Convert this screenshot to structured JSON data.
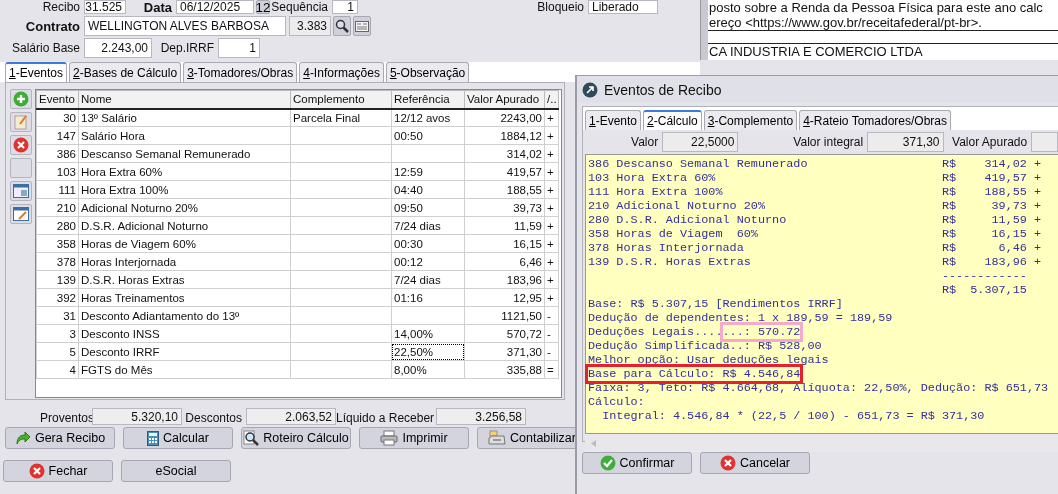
{
  "form": {
    "recibo": {
      "label": "Recibo",
      "value": "31.525"
    },
    "data": {
      "label": "Data",
      "value": "06/12/2025",
      "calendar": "12"
    },
    "sequencia": {
      "label": "Sequência",
      "value": "1"
    },
    "bloqueio": {
      "label": "Bloqueio",
      "value": "Liberado"
    },
    "contrato": {
      "label": "Contrato",
      "name": "WELLINGTON ALVES BARBOSA",
      "code": "3.383"
    },
    "salario_base": {
      "label": "Salário Base",
      "value": "2.243,00"
    },
    "dep_irrf": {
      "label": "Dep.IRRF",
      "value": "1"
    }
  },
  "document": {
    "lines": [
      "posto sobre a Renda da Pessoa Física para este ano calc",
      "ereço <https://www.gov.br/receitafederal/pt-br>.",
      "CA INDUSTRIA E COMERCIO LTDA"
    ]
  },
  "tabs": [
    {
      "label": "1-Eventos",
      "selected": true
    },
    {
      "label": "2-Bases de Cálculo",
      "selected": false
    },
    {
      "label": "3-Tomadores/Obras",
      "selected": false
    },
    {
      "label": "4-Informações",
      "selected": false
    },
    {
      "label": "5-Observação",
      "selected": false
    }
  ],
  "events_table": {
    "columns": [
      "Evento",
      "Nome",
      "Complemento",
      "Referência",
      "Valor Apurado",
      "/.."
    ],
    "rows": [
      {
        "evento": "30",
        "nome": "13º Salário",
        "complemento": "Parcela Final",
        "referencia": "12/12 avos",
        "valor": "2243,00",
        "sinal": "+",
        "focused": false
      },
      {
        "evento": "147",
        "nome": "Salário Hora",
        "referencia": "00:50",
        "valor": "1884,12",
        "sinal": "+",
        "focused": false
      },
      {
        "evento": "386",
        "nome": "Descanso Semanal Remunerado",
        "valor": "314,02",
        "sinal": "+",
        "focused": false
      },
      {
        "evento": "103",
        "nome": "Hora Extra 60%",
        "referencia": "12:59",
        "valor": "419,57",
        "sinal": "+",
        "focused": false
      },
      {
        "evento": "111",
        "nome": "Hora Extra 100%",
        "referencia": "04:40",
        "valor": "188,55",
        "sinal": "+",
        "focused": false
      },
      {
        "evento": "210",
        "nome": "Adicional Noturno 20%",
        "referencia": "09:50",
        "valor": "39,73",
        "sinal": "+",
        "focused": false
      },
      {
        "evento": "280",
        "nome": "D.S.R. Adicional Noturno",
        "referencia": "7/24 dias",
        "valor": "11,59",
        "sinal": "+",
        "focused": false
      },
      {
        "evento": "358",
        "nome": "Horas de Viagem  60%",
        "referencia": "00:30",
        "valor": "16,15",
        "sinal": "+",
        "focused": false
      },
      {
        "evento": "378",
        "nome": "Horas Interjornada",
        "referencia": "00:12",
        "valor": "6,46",
        "sinal": "+",
        "focused": false
      },
      {
        "evento": "139",
        "nome": "D.S.R. Horas Extras",
        "referencia": "7/24 dias",
        "valor": "183,96",
        "sinal": "+",
        "focused": false
      },
      {
        "evento": "392",
        "nome": "Horas Treinamentos",
        "referencia": "01:16",
        "valor": "12,95",
        "sinal": "+",
        "focused": false
      },
      {
        "evento": "31",
        "nome": "Desconto Adiantamento do 13º",
        "valor": "1121,50",
        "sinal": "-",
        "focused": false
      },
      {
        "evento": "3",
        "nome": "Desconto INSS",
        "referencia": "14,00%",
        "valor": "570,72",
        "sinal": "-",
        "focused": false
      },
      {
        "evento": "5",
        "nome": "Desconto IRRF",
        "referencia": "22,50%",
        "valor": "371,30",
        "sinal": "-",
        "focused": true
      },
      {
        "evento": "4",
        "nome": "FGTS do Mês",
        "referencia": "8,00%",
        "valor": "335,88",
        "sinal": "=",
        "focused": false
      }
    ]
  },
  "totals": [
    {
      "label": "Proventos",
      "value": "5.320,10"
    },
    {
      "label": "Descontos",
      "value": "2.063,52"
    },
    {
      "label": "Líquido a Receber",
      "value": "3.256,58"
    }
  ],
  "buttons": [
    [
      {
        "label": "Gera Recibo",
        "kind": "forward"
      },
      {
        "label": "Calcular",
        "kind": "calculator"
      },
      {
        "label": "Roteiro Cálculo",
        "kind": "search"
      },
      {
        "label": "Imprimir",
        "kind": "printer"
      },
      {
        "label": "Contabilizar",
        "kind": "register"
      }
    ],
    [
      {
        "label": "Fechar",
        "kind": "close"
      },
      {
        "label": "eSocial",
        "kind": "none"
      }
    ]
  ],
  "dialog": {
    "title": "Eventos de Recibo",
    "tabs": [
      {
        "label": "1-Evento",
        "selected": false
      },
      {
        "label": "2-Cálculo",
        "selected": true
      },
      {
        "label": "3-Complemento",
        "selected": false
      },
      {
        "label": "4-Rateio Tomadores/Obras",
        "selected": false
      }
    ],
    "fields": [
      {
        "label": "Valor",
        "value": "22,5000"
      },
      {
        "label": "Valor integral",
        "value": "371,30"
      },
      {
        "label": "Valor Apurado"
      }
    ],
    "memo": [
      {
        "kind": "entry",
        "text": "386 Descanso Semanal Remunerado",
        "currency": "R$",
        "amount": "314,02",
        "sign": "+"
      },
      {
        "kind": "entry",
        "text": "103 Hora Extra 60%",
        "currency": "R$",
        "amount": "419,57",
        "sign": "+"
      },
      {
        "kind": "entry",
        "text": "111 Hora Extra 100%",
        "currency": "R$",
        "amount": "188,55",
        "sign": "+"
      },
      {
        "kind": "entry",
        "text": "210 Adicional Noturno 20%",
        "currency": "R$",
        "amount": "39,73",
        "sign": "+"
      },
      {
        "kind": "entry",
        "text": "280 D.S.R. Adicional Noturno",
        "currency": "R$",
        "amount": "11,59",
        "sign": "+"
      },
      {
        "kind": "entry",
        "text": "358 Horas de Viagem  60%",
        "currency": "R$",
        "amount": "16,15",
        "sign": "+"
      },
      {
        "kind": "entry",
        "text": "378 Horas Interjornada",
        "currency": "R$",
        "amount": "6,46",
        "sign": "+"
      },
      {
        "kind": "entry",
        "text": "139 D.S.R. Horas Extras",
        "currency": "R$",
        "amount": "183,96",
        "sign": "+"
      },
      {
        "kind": "rule",
        "text": "------------"
      },
      {
        "kind": "entry",
        "currency": "R$",
        "amount": "5.307,15"
      },
      {
        "kind": "text",
        "text": "Base: R$ 5.307,15 [Rendimentos IRRF]"
      },
      {
        "kind": "text",
        "text": "Dedução de dependentes: 1 x 189,59 = 189,59"
      },
      {
        "kind": "text",
        "text": "Deduções Legais....",
        "boxed": "...: 570.72",
        "color": "#f5a9cb"
      },
      {
        "kind": "text",
        "text": "Dedução Simplificada..: R$ 528,00"
      },
      {
        "kind": "text",
        "text": "Melhor opção: Usar deduções legais"
      },
      {
        "kind": "text",
        "boxed": "Base para Cálculo: R$ 4.546,84",
        "color": "#e8202a"
      },
      {
        "kind": "text",
        "text": "Faixa: 3, Teto: R$ 4.664,68, Alíquota: 22,50%, Dedução: R$ 651,73"
      },
      {
        "kind": "text",
        "text": "Cálculo:"
      },
      {
        "kind": "indented",
        "text": "Integral: 4.546,84 * (22,5 / 100) - 651,73 = R$ 371,30"
      }
    ],
    "buttons": [
      {
        "label": "Confirmar",
        "kind": "confirm"
      },
      {
        "label": "Cancelar",
        "kind": "close"
      }
    ]
  }
}
